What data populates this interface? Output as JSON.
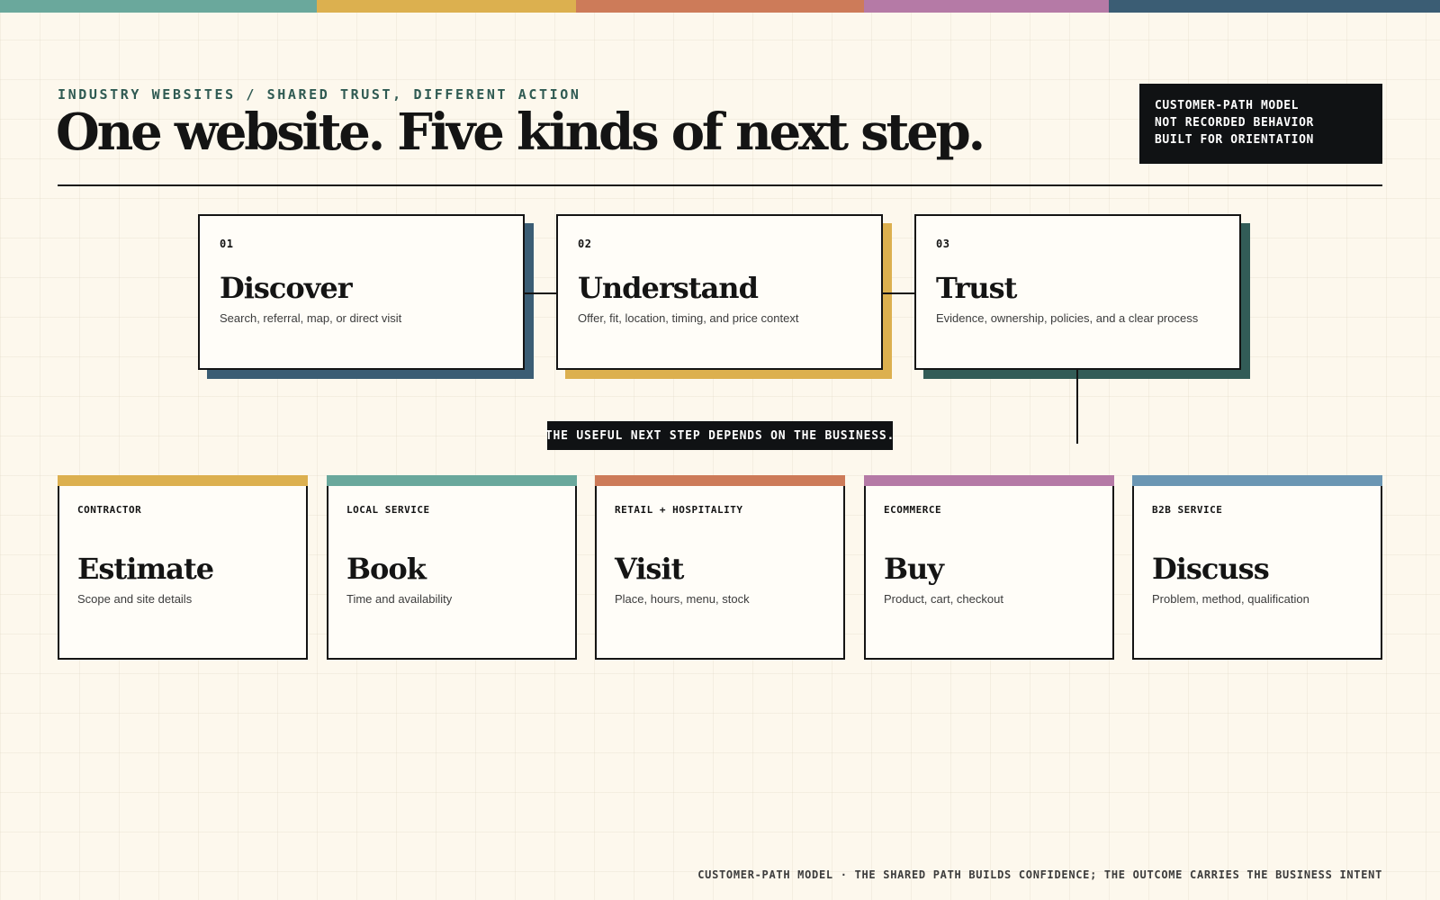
{
  "palette": {
    "teal": "#6aa89c",
    "gold": "#dcb04f",
    "terracotta": "#cd7b59",
    "mauve": "#b57aa6",
    "navy": "#3b5d74",
    "steel": "#6b96b3",
    "forest": "#325c57",
    "ink": "#141414",
    "paper": "#fdf8ed"
  },
  "top_bar": [
    {
      "color": "#6aa89c",
      "share": 0.22
    },
    {
      "color": "#dcb04f",
      "share": 0.18
    },
    {
      "color": "#cd7b59",
      "share": 0.2
    },
    {
      "color": "#b57aa6",
      "share": 0.17
    },
    {
      "color": "#3b5d74",
      "share": 0.23
    }
  ],
  "header": {
    "kicker": "INDUSTRY WEBSITES / SHARED TRUST, DIFFERENT ACTION",
    "title": "One website. Five kinds of next step."
  },
  "model_note": {
    "lines": [
      "CUSTOMER-PATH MODEL",
      "NOT RECORDED BEHAVIOR",
      "BUILT FOR ORIENTATION"
    ]
  },
  "shared_path": {
    "stages": [
      {
        "number": "01",
        "title": "Discover",
        "description": "Search, referral, map, or direct visit",
        "shadow_color": "#3b5d74"
      },
      {
        "number": "02",
        "title": "Understand",
        "description": "Offer, fit, location, timing, and price context",
        "shadow_color": "#dcb04f"
      },
      {
        "number": "03",
        "title": "Trust",
        "description": "Evidence, ownership, policies, and a clear process",
        "shadow_color": "#325c57"
      }
    ],
    "branch_label": "THE USEFUL NEXT STEP DEPENDS ON THE BUSINESS."
  },
  "outcomes": [
    {
      "industry": "CONTRACTOR",
      "title": "Estimate",
      "description": "Scope and site details",
      "accent": "#dcb04f"
    },
    {
      "industry": "LOCAL SERVICE",
      "title": "Book",
      "description": "Time and availability",
      "accent": "#6aa89c"
    },
    {
      "industry": "RETAIL + HOSPITALITY",
      "title": "Visit",
      "description": "Place, hours, menu, stock",
      "accent": "#cd7b59"
    },
    {
      "industry": "ECOMMERCE",
      "title": "Buy",
      "description": "Product, cart, checkout",
      "accent": "#b57aa6"
    },
    {
      "industry": "B2B SERVICE",
      "title": "Discuss",
      "description": "Problem, method, qualification",
      "accent": "#6b96b3"
    }
  ],
  "footer": {
    "text": "CUSTOMER-PATH MODEL · THE SHARED PATH BUILDS CONFIDENCE; THE OUTCOME CARRIES THE BUSINESS INTENT"
  }
}
